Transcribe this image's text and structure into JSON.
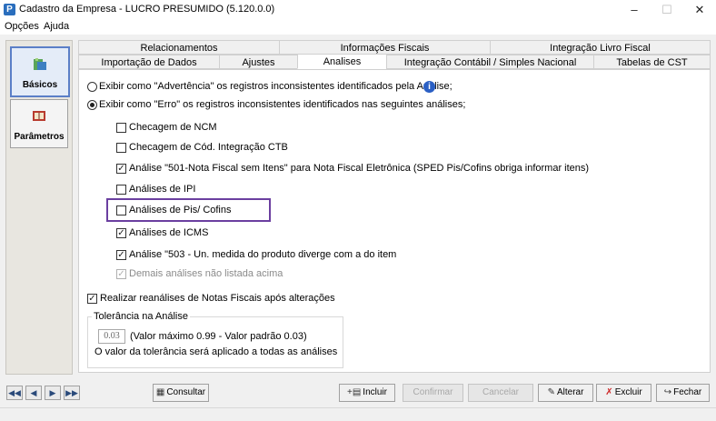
{
  "window": {
    "title": "Cadastro da Empresa - LUCRO PRESUMIDO (5.120.0.0)",
    "app_icon": "P"
  },
  "menu": {
    "items": [
      "Opções",
      "Ajuda"
    ]
  },
  "sidebar": {
    "items": [
      {
        "label": "Básicos",
        "icon": "tree-icon"
      },
      {
        "label": "Parâmetros",
        "icon": "book-icon"
      }
    ]
  },
  "tabs": {
    "row1": [
      "Relacionamentos",
      "Informações Fiscais",
      "Integração Livro Fiscal"
    ],
    "row2": [
      "Importação de Dados",
      "Ajustes",
      "Analises",
      "Integração Contábil / Simples Nacional",
      "Tabelas de CST"
    ],
    "selected": "Analises"
  },
  "analises": {
    "radio_advertencia": "Exibir como \"Advertência\" os registros inconsistentes identificados pela Análise;",
    "radio_erro": "Exibir como \"Erro\" os registros inconsistentes identificados nas seguintes análises;",
    "checks": [
      {
        "label": "Checagem de NCM",
        "checked": false,
        "disabled": false
      },
      {
        "label": "Checagem de Cód. Integração CTB",
        "checked": false,
        "disabled": false
      },
      {
        "label": "Análise \"501-Nota Fiscal sem Itens\" para Nota Fiscal Eletrônica (SPED Pis/Cofins obriga informar itens)",
        "checked": true,
        "disabled": false
      },
      {
        "label": "Análises de IPI",
        "checked": false,
        "disabled": false
      },
      {
        "label": "Análises de Pis/ Cofins",
        "checked": false,
        "disabled": false
      },
      {
        "label": "Análises de ICMS",
        "checked": true,
        "disabled": false
      },
      {
        "label": "Análise \"503 - Un. medida do produto diverge com a do item",
        "checked": true,
        "disabled": false
      },
      {
        "label": "Demais análises não listada acima",
        "checked": true,
        "disabled": true
      }
    ],
    "reanalise": "Realizar reanálises de Notas Fiscais após alterações",
    "tolerancia": {
      "title": "Tolerância na Análise",
      "value": "0.03",
      "hint": "(Valor máximo 0.99 - Valor padrão 0.03)",
      "note": "O valor da tolerância será aplicado a todas as análises"
    }
  },
  "buttons": {
    "consultar": "Consultar",
    "incluir": "Incluir",
    "confirmar": "Confirmar",
    "cancelar": "Cancelar",
    "alterar": "Alterar",
    "excluir": "Excluir",
    "fechar": "Fechar"
  },
  "colors": {
    "highlight": "#6b3fa0",
    "info": "#2a5fc4",
    "active_sidebar": "#5b7fc7"
  }
}
